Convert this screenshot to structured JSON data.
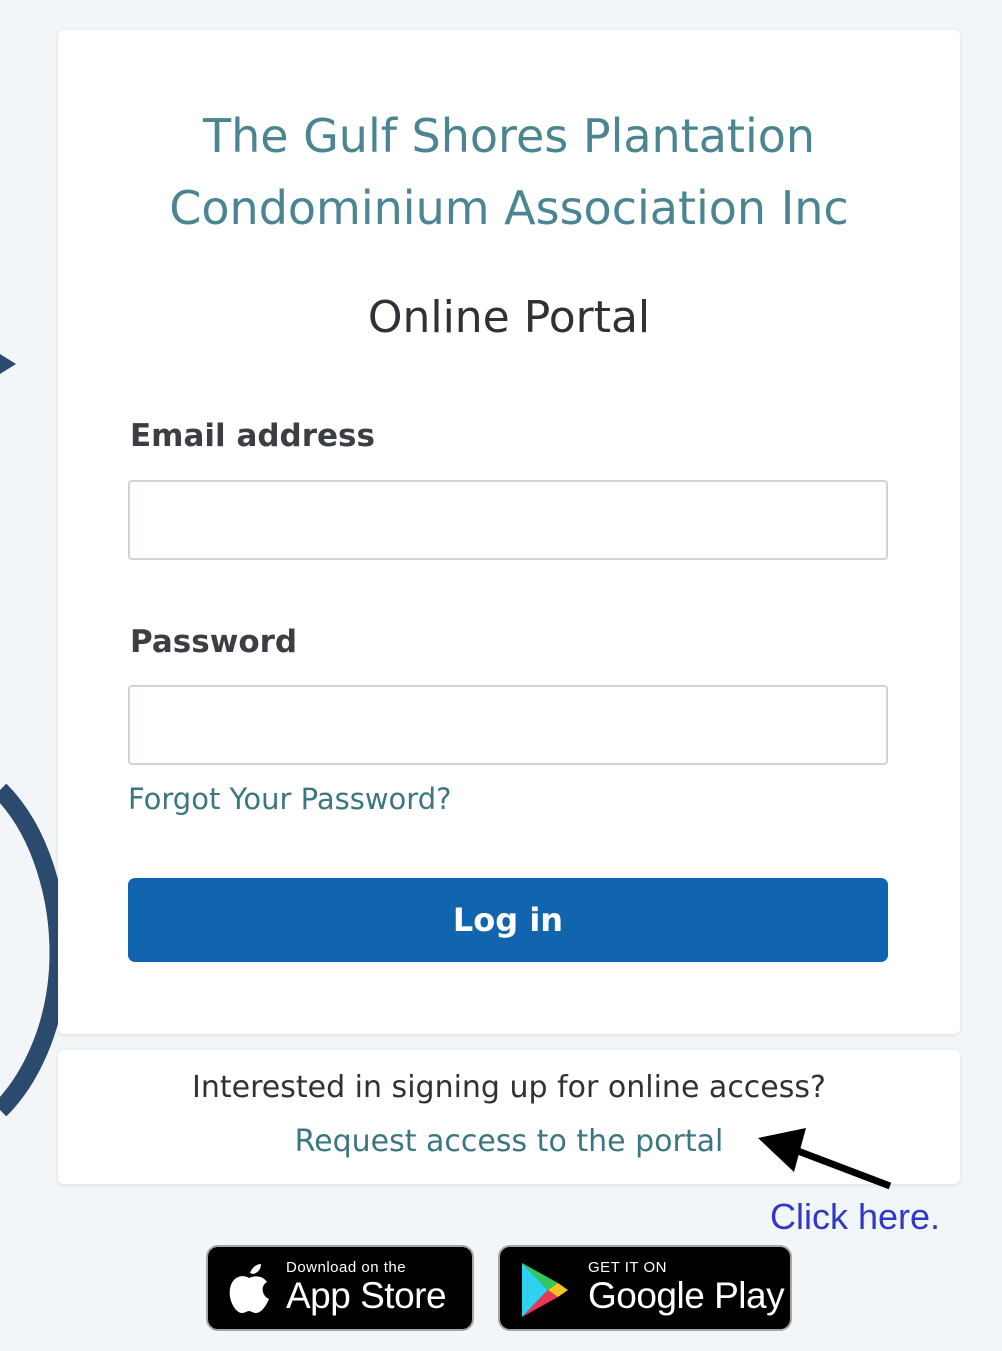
{
  "organization": {
    "title": "The Gulf Shores Plantation\nCondominium Association Inc"
  },
  "portal": {
    "title": "Online Portal"
  },
  "form": {
    "email_label": "Email address",
    "email_value": "",
    "password_label": "Password",
    "password_value": "",
    "forgot_password_link": "Forgot Your Password?",
    "login_button": "Log in"
  },
  "signup": {
    "prompt": "Interested in signing up for online access?",
    "request_link": "Request access to the portal"
  },
  "annotation": {
    "click_here": "Click here."
  },
  "stores": {
    "app_store": {
      "small_text": "Download on the",
      "big_text": "App Store",
      "icon": "apple-icon"
    },
    "google_play": {
      "small_text": "GET IT ON",
      "big_text": "Google Play",
      "icon": "google-play-icon"
    }
  },
  "colors": {
    "page_background": "#f3f6f8",
    "title_teal": "#4a8591",
    "link_teal": "#3c7683",
    "primary_button": "#1165ae",
    "annotation_blue": "#2f38c9",
    "curve_navy": "#2c4a6e"
  }
}
